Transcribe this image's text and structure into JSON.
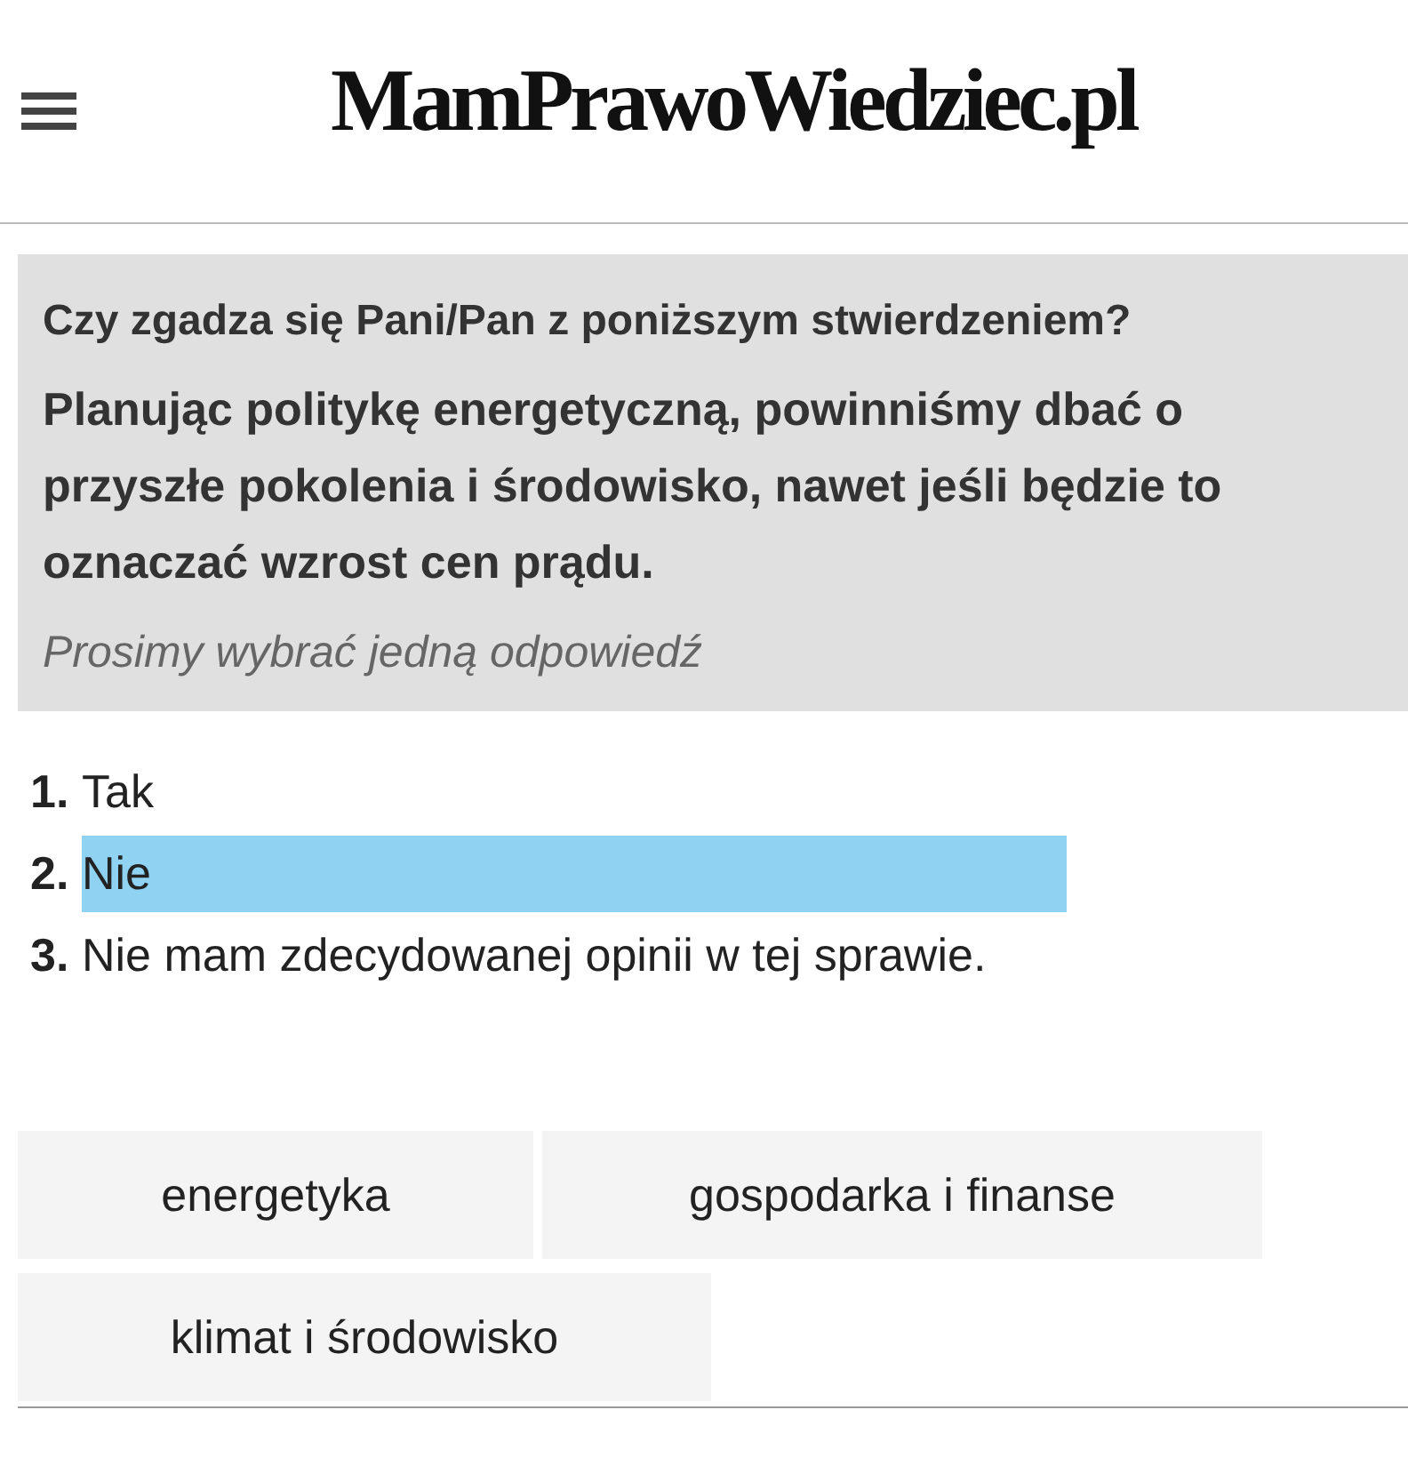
{
  "header": {
    "title": "MamPrawoWiedziec.pl"
  },
  "question": {
    "prompt": "Czy zgadza się Pani/Pan z poniższym stwierdzeniem?",
    "statement": "Planując politykę energetyczną, powinniśmy dbać o przyszłe pokolenia i środowisko, nawet jeśli będzie to oznaczać wzrost cen prądu.",
    "hint": "Prosimy wybrać jedną odpowiedź"
  },
  "answers": [
    {
      "number": "1.",
      "label": "Tak",
      "selected": false
    },
    {
      "number": "2.",
      "label": "Nie",
      "selected": true
    },
    {
      "number": "3.",
      "label": "Nie mam zdecydowanej opinii w tej sprawie.",
      "selected": false
    }
  ],
  "tags": [
    "energetyka",
    "gospodarka i finanse",
    "klimat i środowisko"
  ]
}
